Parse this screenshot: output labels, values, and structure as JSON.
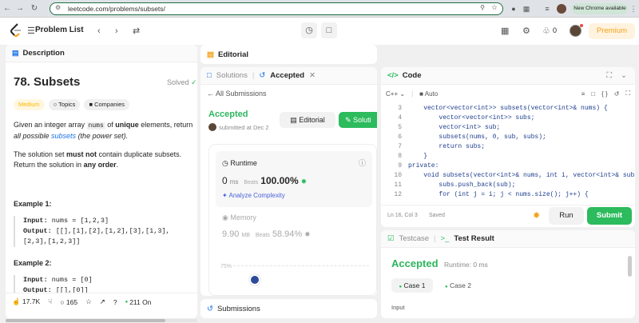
{
  "browser": {
    "url": "leetcode.com/problems/subsets/",
    "new_chrome": "New Chrome available"
  },
  "topbar": {
    "problem_list": "Problem List",
    "streak_count": "0",
    "premium": "Premium"
  },
  "description": {
    "tab": "Description",
    "title": "78. Subsets",
    "status": "Solved",
    "difficulty": "Medium",
    "topics": "Topics",
    "companies": "Companies",
    "p1_a": "Given an integer array ",
    "p1_code": "nums",
    "p1_b": " of ",
    "p1_bold": "unique",
    "p1_c": " elements, return",
    "p1_italic": "all possible ",
    "p1_link": "subsets",
    "p1_italic2": " (the power set).",
    "p2_a": "The solution set ",
    "p2_bold": "must not",
    "p2_b": " contain duplicate subsets.",
    "p2_c": "Return the solution in ",
    "p2_bold2": "any order",
    "p2_d": ".",
    "ex1_title": "Example 1:",
    "ex1_input_label": "Input:",
    "ex1_input": " nums = [1,2,3]",
    "ex1_output_label": "Output:",
    "ex1_output_1": " [[],[1],[2],[1,2],[3],[1,3],",
    "ex1_output_2": "[2,3],[1,2,3]]",
    "ex2_title": "Example 2:",
    "ex2_input_label": "Input:",
    "ex2_input": " nums = [0]",
    "ex2_output_label": "Output:",
    "ex2_output": " [[],[0]]",
    "likes": "17.7K",
    "comments": "165",
    "online": "211 On"
  },
  "editorial": {
    "tab": "Editorial"
  },
  "solutions": {
    "tab_solutions": "Solutions",
    "tab_accepted": "Accepted",
    "all_submissions": "All Submissions",
    "status": "Accepted",
    "submitted": "submitted at Dec 2",
    "editorial_btn": "Editorial",
    "solution_btn": "Soluti",
    "runtime_label": "Runtime",
    "runtime_value": "0",
    "runtime_unit": "ms",
    "beats_label": "Beats",
    "runtime_beats": "100.00%",
    "analyze": "Analyze Complexity",
    "memory_label": "Memory",
    "memory_value": "9.90",
    "memory_unit": "MB",
    "memory_beats": "58.94%",
    "chart_tick": "75%",
    "submissions_tab": "Submissions"
  },
  "code": {
    "tab": "Code",
    "language": "C++",
    "mode": "Auto",
    "line_numbers": [
      "3",
      "4",
      "5",
      "6",
      "7",
      "8",
      "9",
      "10",
      "11",
      "12"
    ],
    "lines": [
      "    vector<vector<int>> subsets(vector<int>& nums) {",
      "        vector<vector<int>> subs;",
      "        vector<int> sub;",
      "        subsets(nums, 0, sub, subs);",
      "        return subs;",
      "    }",
      "private:",
      "    void subsets(vector<int>& nums, int i, vector<int>& sub,",
      "        subs.push_back(sub);",
      "        for (int j = i; j < nums.size(); j++) {"
    ],
    "status": "Ln 16, Col 3",
    "saved": "Saved",
    "run": "Run",
    "submit": "Submit"
  },
  "testresult": {
    "tab_testcase": "Testcase",
    "tab_result": "Test Result",
    "status": "Accepted",
    "runtime": "Runtime: 0 ms",
    "case1": "Case 1",
    "case2": "Case 2",
    "input_label": "Input"
  },
  "colors": {
    "accent_green": "#2cbb5d",
    "accepted_green": "#2db55d",
    "medium": "#ffb800",
    "premium": "#f2a31d",
    "link_blue": "#1a73e8"
  }
}
